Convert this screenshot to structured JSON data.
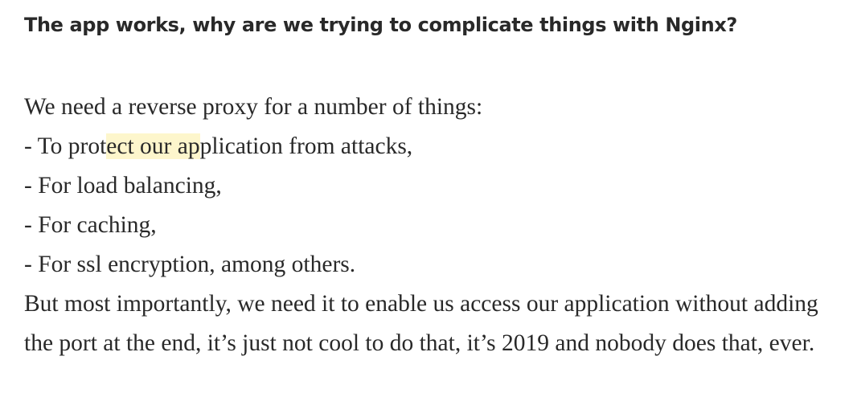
{
  "article": {
    "heading": "The app works, why are we trying to complicate things with Nginx?",
    "intro": "We need a reverse proxy for a number of things:",
    "list": [
      {
        "parts": [
          "- To prot",
          "ect our ap",
          "plication from attacks,"
        ]
      },
      {
        "text": "- For load balancing,"
      },
      {
        "text": "- For caching,"
      },
      {
        "text": "- For ssl encryption, among others."
      }
    ],
    "closing": "But most importantly, we need it to enable us access our application without adding the port at the end, it’s just not cool to do that, it’s 2019 and nobody does that, ever."
  },
  "colors": {
    "text": "#292929",
    "highlight": "#fdf6cc",
    "background": "#ffffff"
  }
}
